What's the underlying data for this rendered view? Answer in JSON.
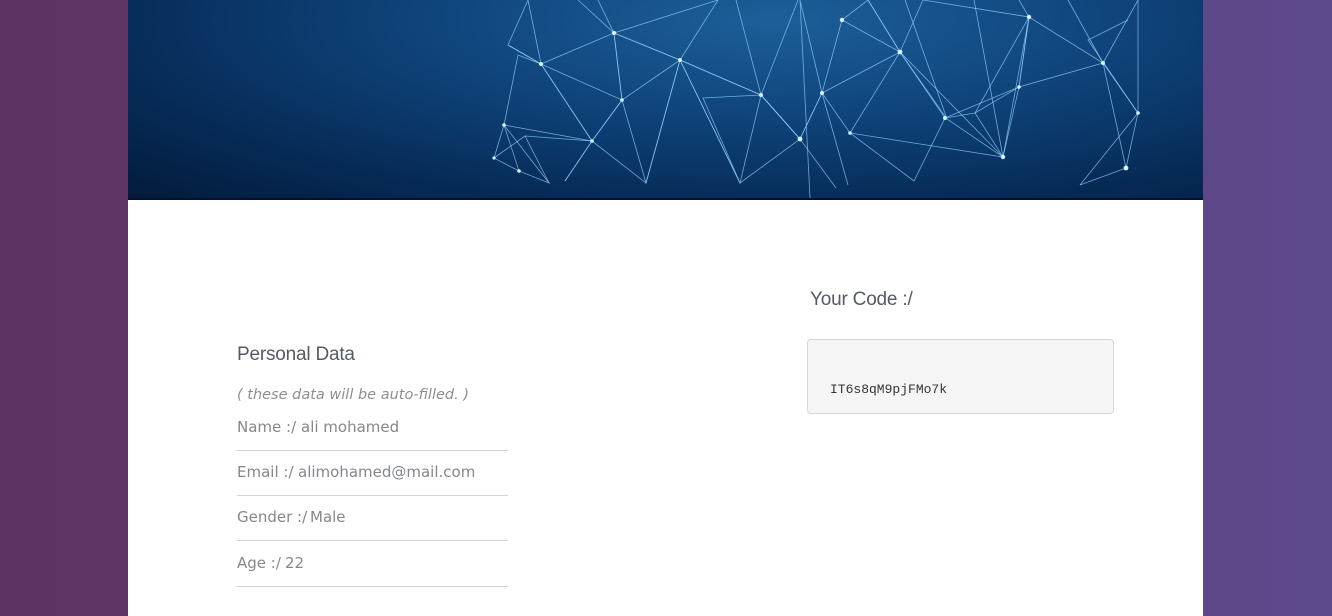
{
  "banner": {
    "image": "network-polygon-mesh"
  },
  "code": {
    "title": "Your Code :/",
    "value": "IT6s8qM9pjFMo7k"
  },
  "personal": {
    "title": "Personal Data",
    "note": "( these data will be auto-filled. )",
    "fields": [
      {
        "label": "Name :/",
        "value": "ali mohamed"
      },
      {
        "label": "Email :/",
        "value": "alimohamed@mail.com"
      },
      {
        "label": "Gender :/",
        "value": "Male"
      },
      {
        "label": "Age :/",
        "value": "22"
      }
    ]
  }
}
